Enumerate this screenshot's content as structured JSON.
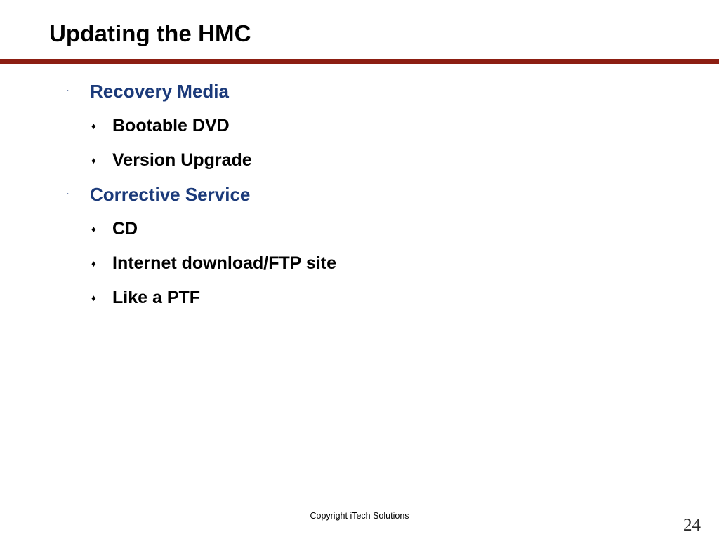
{
  "slide": {
    "title": "Updating the HMC",
    "accent_color": "#8C1E12",
    "level1_color": "#1B3A7A",
    "level2_color": "#000000",
    "background_color": "#FFFFFF"
  },
  "bullets": [
    {
      "level": 1,
      "glyph": "dot-bullet",
      "marker": "·",
      "text": "Recovery Media"
    },
    {
      "level": 2,
      "glyph": "diamond-bullet",
      "marker": "♦",
      "text": "Bootable DVD"
    },
    {
      "level": 2,
      "glyph": "diamond-bullet",
      "marker": "♦",
      "text": "Version Upgrade"
    },
    {
      "level": 1,
      "glyph": "dot-bullet",
      "marker": "·",
      "text": "Corrective Service"
    },
    {
      "level": 2,
      "glyph": "diamond-bullet",
      "marker": "♦",
      "text": "CD"
    },
    {
      "level": 2,
      "glyph": "diamond-bullet",
      "marker": "♦",
      "text": "Internet download/FTP site"
    },
    {
      "level": 2,
      "glyph": "diamond-bullet",
      "marker": "♦",
      "text": "Like a PTF"
    }
  ],
  "footer": {
    "copyright": "Copyright iTech Solutions",
    "page_number": "24"
  }
}
